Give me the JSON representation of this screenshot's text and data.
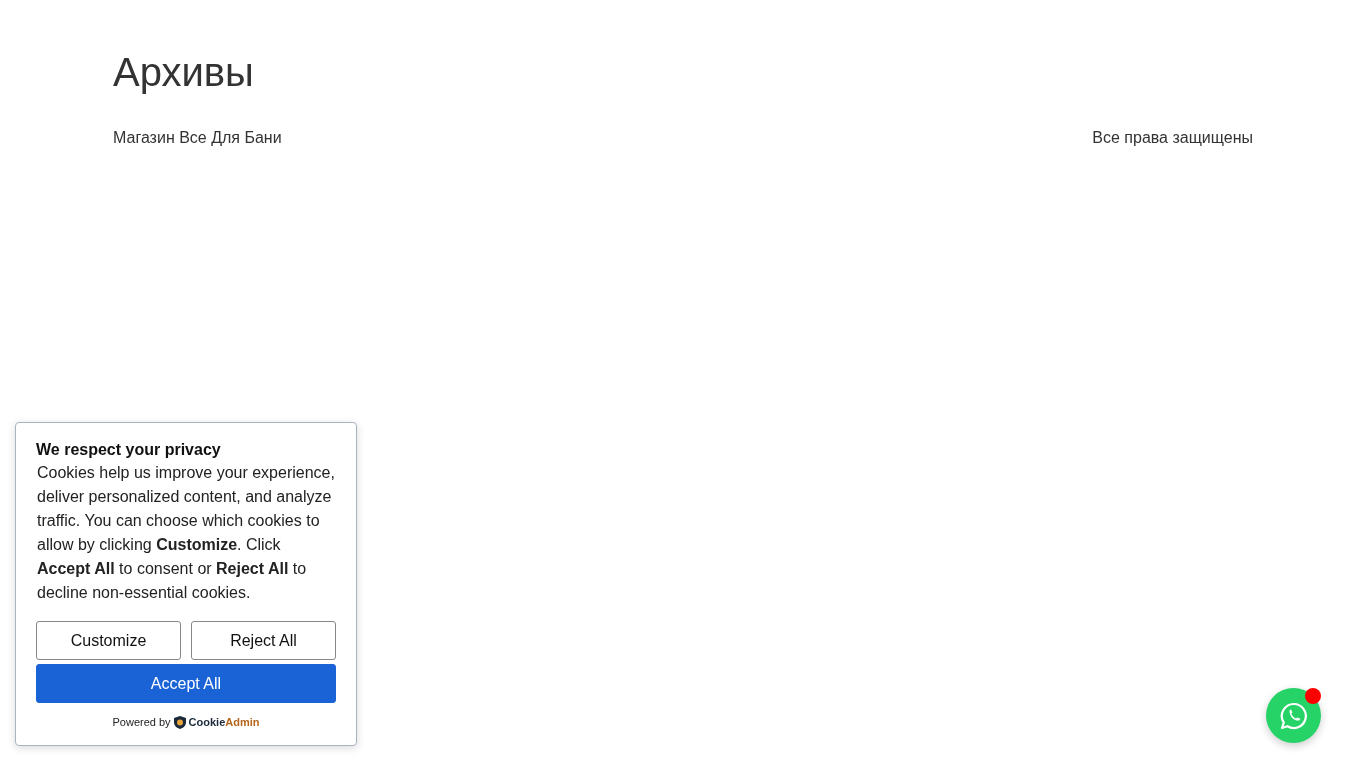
{
  "page": {
    "title": "Архивы"
  },
  "footer": {
    "site_name": "Магазин Все Для Бани",
    "copyright": "Все права защищены"
  },
  "cookie_banner": {
    "title": "We respect your privacy",
    "body": "Cookies help us improve your experience, deliver personalized content, and analyze traffic. You can choose which cookies to allow by clicking **Customize**. Click **Accept All** to consent or **Reject All** to decline non-essential cookies.",
    "buttons": [
      {
        "label": "Customize",
        "kind": "outline"
      },
      {
        "label": "Reject All",
        "kind": "outline"
      },
      {
        "label": "Accept All",
        "kind": "primary"
      }
    ],
    "powered_by": "Powered by",
    "brand": [
      "Cookie",
      "Admin"
    ]
  },
  "chat_button": {
    "notification": true
  }
}
